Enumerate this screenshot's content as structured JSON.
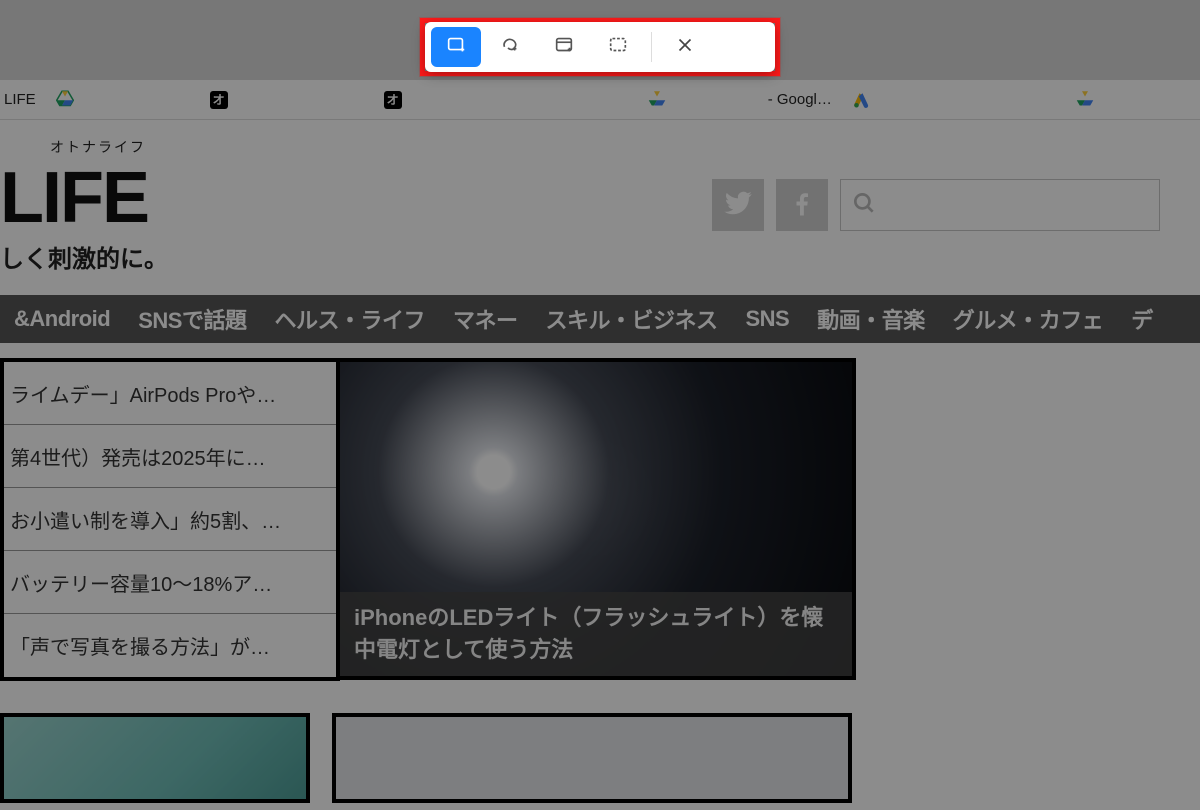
{
  "bookmarks": {
    "item0": "LIFE",
    "item4_suffix": "- Googl…"
  },
  "site": {
    "logo_kana": "オトナライフ",
    "logo_main": " LIFE",
    "tagline": "しく刺激的に。"
  },
  "nav": {
    "items": [
      "&Android",
      "SNSで話題",
      "ヘルス・ライフ",
      "マネー",
      "スキル・ビジネス",
      "SNS",
      "動画・音楽",
      "グルメ・カフェ",
      "デ"
    ]
  },
  "sidebar": {
    "rows": [
      "ライムデー」AirPods Proや…",
      "第4世代）発売は2025年に…",
      "お小遣い制を導入」約5割、…",
      "バッテリー容量10〜18%ア…",
      "「声で写真を撮る方法」が…"
    ]
  },
  "featured": {
    "caption": "iPhoneのLEDライト（フラッシュライト）を懐中電灯として使う方法"
  },
  "capture_toolbar": {
    "tooltips": {
      "area": "領域をキャプチャ",
      "free": "自由形式をキャプチャ",
      "window": "ウィンドウをキャプチャ",
      "full": "全画面をキャプチャ",
      "close": "閉じる"
    }
  }
}
